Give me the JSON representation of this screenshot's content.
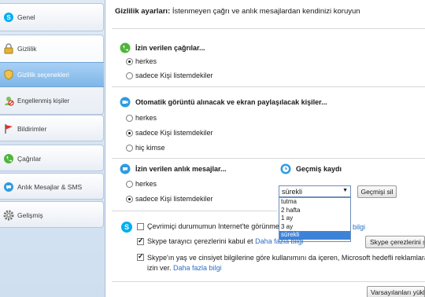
{
  "sidebar": {
    "items": [
      {
        "label": "Genel",
        "icon": "skype-icon"
      },
      {
        "label": "Gizlilik",
        "icon": "lock-icon"
      },
      {
        "label": "Gizlilik seçenekleri",
        "icon": "shield-icon"
      },
      {
        "label": "Engellenmiş kişiler",
        "icon": "blocked-user-icon"
      },
      {
        "label": "Bildirimler",
        "icon": "flag-icon"
      },
      {
        "label": "Çağrılar",
        "icon": "phone-icon"
      },
      {
        "label": "Anlık Mesajlar & SMS",
        "icon": "chat-icon"
      },
      {
        "label": "Gelişmiş",
        "icon": "gear-icon"
      }
    ]
  },
  "header": {
    "title_bold": "Gizlilik ayarları:",
    "title_rest": " İstenmeyen çağrı ve anlık mesajlardan kendinizi koruyun"
  },
  "calls": {
    "heading": "İzin verilen çağrılar...",
    "options": [
      "herkes",
      "sadece Kişi listemdekiler"
    ],
    "selected": 0
  },
  "video": {
    "heading": "Otomatik görüntü alınacak ve ekran paylaşılacak kişiler...",
    "options": [
      "herkes",
      "sadece Kişi listemdekiler",
      "hiç kimse"
    ],
    "selected": 1
  },
  "im": {
    "heading": "İzin verilen anlık mesajlar...",
    "options": [
      "herkes",
      "sadece Kişi listemdekiler"
    ],
    "selected": 1
  },
  "history": {
    "heading": "Geçmiş kaydı",
    "selected_value": "sürekli",
    "clear_button": "Geçmişi sil",
    "options": [
      "tutma",
      "2 hafta",
      "1 ay",
      "3 ay",
      "sürekli"
    ],
    "highlighted": 4
  },
  "checks": {
    "online_status": {
      "text": "Çevrimiçi durumumun Internet'te görünme",
      "link_tail": "bilgi",
      "checked": false
    },
    "cookies": {
      "text": "Skype tarayıcı çerezlerini kabul et",
      "link": "Daha fazla bilgi",
      "button": "Skype çerezlerini sil",
      "checked": true
    },
    "ads": {
      "line1": "Skype'ın yaş ve cinsiyet bilgilerine göre kullanımını da içeren, Microsoft hedefli reklamlara",
      "line2": "izin ver.",
      "link": "Daha fazla bilgi",
      "checked": true
    }
  },
  "footer": {
    "defaults_button": "Varsayılanları yükle"
  },
  "colors": {
    "accent": "#3c83d8",
    "link": "#2c6fc4",
    "sidebar_active": "#7fb6e8"
  }
}
